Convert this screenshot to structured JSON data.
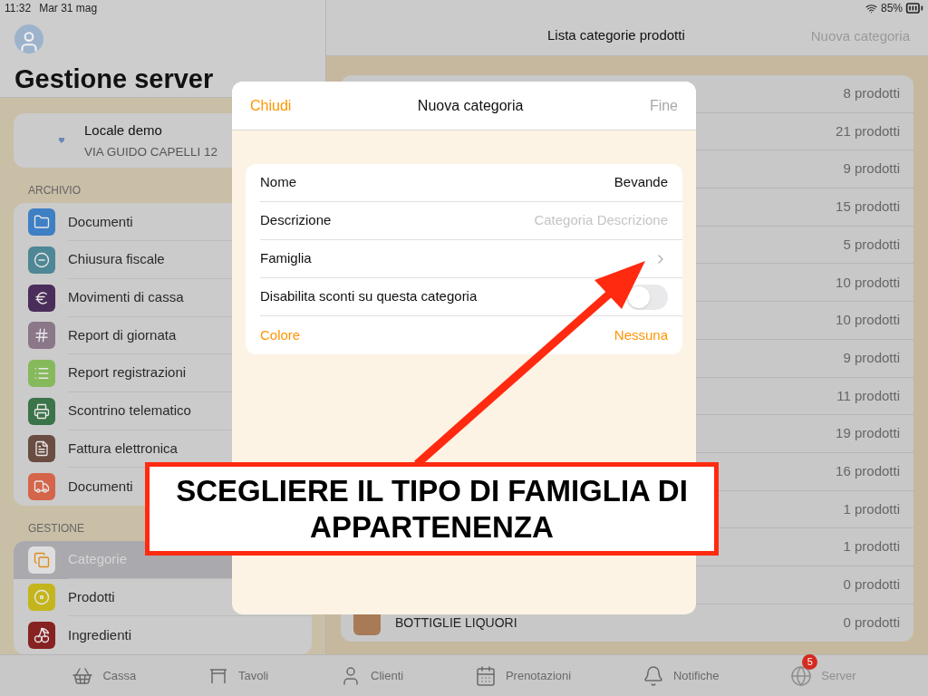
{
  "status_bar": {
    "time": "11:32",
    "date": "Mar 31 mag",
    "battery": "85%"
  },
  "sidebar": {
    "title": "Gestione server",
    "venue": {
      "name": "Locale demo",
      "address": "VIA GUIDO CAPELLI 12"
    },
    "sections": [
      {
        "label": "ARCHIVIO",
        "items": [
          {
            "label": "Documenti",
            "kind": "folder",
            "color": "#3f7fc4",
            "selected": false
          },
          {
            "label": "Chiusura fiscale",
            "kind": "minus",
            "color": "#4e8795",
            "selected": false
          },
          {
            "label": "Movimenti di cassa",
            "kind": "euro",
            "color": "#4a2d5a",
            "selected": false
          },
          {
            "label": "Report di giornata",
            "kind": "numbers",
            "color": "#8a7788",
            "selected": false
          },
          {
            "label": "Report registrazioni",
            "kind": "list",
            "color": "#86b95c",
            "selected": false
          },
          {
            "label": "Scontrino telematico",
            "kind": "printer",
            "color": "#3c744a",
            "selected": false
          },
          {
            "label": "Fattura elettronica",
            "kind": "document",
            "color": "#6a4c42",
            "selected": false
          },
          {
            "label": "Documenti",
            "kind": "truck",
            "color": "#d5654a",
            "selected": false
          }
        ]
      },
      {
        "label": "GESTIONE",
        "items": [
          {
            "label": "Categorie",
            "kind": "copy",
            "color": "#dedede",
            "selected": true
          },
          {
            "label": "Prodotti",
            "kind": "rings",
            "color": "#c4b51c",
            "selected": false
          },
          {
            "label": "Ingredienti",
            "kind": "cherry",
            "color": "#862222",
            "selected": false
          }
        ]
      }
    ]
  },
  "main": {
    "title": "Lista categorie prodotti",
    "action": "Nuova categoria",
    "rows": [
      {
        "count": "8 prodotti"
      },
      {
        "count": "21 prodotti"
      },
      {
        "count": "9 prodotti"
      },
      {
        "count": "15 prodotti"
      },
      {
        "count": "5 prodotti"
      },
      {
        "count": "10 prodotti"
      },
      {
        "count": "10 prodotti"
      },
      {
        "count": "9 prodotti"
      },
      {
        "count": "11 prodotti"
      },
      {
        "count": "19 prodotti"
      },
      {
        "count": "16 prodotti"
      },
      {
        "count": "1 prodotti"
      },
      {
        "count": "1 prodotti"
      },
      {
        "count": "0 prodotti"
      },
      {
        "name": "BOTTIGLIE LIQUORI",
        "count": "0 prodotti",
        "color": "#a87a56"
      }
    ]
  },
  "modal": {
    "title": "Nuova categoria",
    "close": "Chiudi",
    "done": "Fine",
    "done_disabled": true,
    "fields": [
      {
        "kind": "value",
        "label": "Nome",
        "value": "Bevande"
      },
      {
        "kind": "input",
        "label": "Descrizione",
        "placeholder": "Categoria Descrizione"
      },
      {
        "kind": "link",
        "label": "Famiglia"
      },
      {
        "kind": "toggle",
        "label": "Disabilita sconti su questa categoria",
        "on": false
      },
      {
        "kind": "accent",
        "label": "Colore",
        "value": "Nessuna"
      }
    ]
  },
  "annotation": {
    "lines": [
      "SCEGLIERE IL TIPO DI FAMIGLIA DI",
      "APPARTENENZA"
    ]
  },
  "tab_bar": [
    {
      "label": "Cassa",
      "kind": "basket",
      "selected": false
    },
    {
      "label": "Tavoli",
      "kind": "table",
      "selected": false
    },
    {
      "label": "Clienti",
      "kind": "person",
      "selected": false
    },
    {
      "label": "Prenotazioni",
      "kind": "calendar",
      "selected": false
    },
    {
      "label": "Notifiche",
      "kind": "bell",
      "selected": false
    },
    {
      "label": "Server",
      "kind": "globe",
      "selected": true,
      "badge": "5"
    }
  ]
}
